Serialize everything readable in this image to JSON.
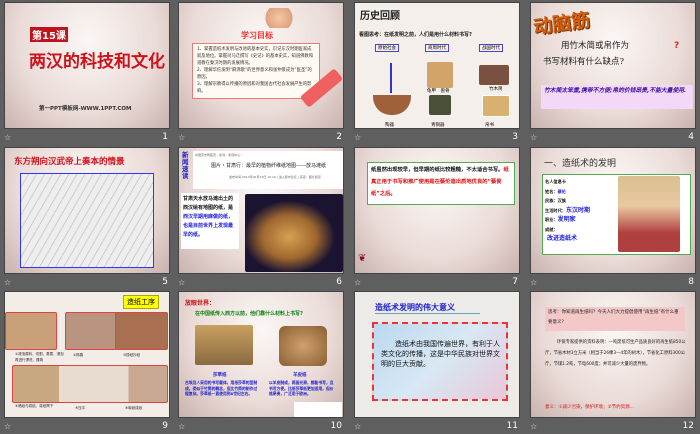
{
  "slides": [
    {
      "number": "1",
      "lesson": "第15课",
      "title": "两汉的科技和文化",
      "footer": "第一PPT模板网-WWW.1PPT.COM"
    },
    {
      "number": "2",
      "heading": "学习目标",
      "items": [
        "1、掌握造纸术发明与改进的基本史实，识记东汉时期医家成就及地位。掌握司马迁撰写《史记》的基本史实，知道佛教和道教在秦汉时期的发展情况。",
        "2、理解华佗发明“麻沸散”的世界意义和张仲景成为“医圣”的原因。",
        "3、理解宗教得以传播的原因和对我国古代社会发展产生的影响。"
      ]
    },
    {
      "number": "3",
      "logo": "历史回顾",
      "question": "看图思考：在纸发明之前，人们是用什么材料书写?",
      "eras": [
        "原始社会",
        "商周时代",
        "战国时代"
      ],
      "labels": [
        "陶器",
        "龟甲　兽骨",
        "青铜器",
        "竹木简",
        "帛书"
      ]
    },
    {
      "number": "4",
      "banner": "动脑筋",
      "question_line1": "用竹木简或帛作为",
      "question_line2": "书写材料有什么缺点?",
      "answer": "竹木简太笨重,携带不方便;帛的价钱昂贵,不能大量使用."
    },
    {
      "number": "5",
      "title": "东方朔向汉武帝上奏本的情景"
    },
    {
      "number": "6",
      "side_title": "新闻速读",
      "breadcrumb": "中国历史网首页 › 新闻 › 新闻中心 ›",
      "headline": "图片・甘肃行：最早的植物纤维纸地图——放马滩纸",
      "meta": "发布时间:2013年09月23日 10:16 | 进入夏中论坛 | 来源：图片频道",
      "text_black": "甘肃天水放马滩出土的西汉绘有地图的纸，是",
      "text_blue": "西汉早期用麻做的纸，也是目前世界上发现最早的纸。"
    },
    {
      "number": "7",
      "text_black": "纸虽然出现较早，但早期的纸比较粗糙，不太适合书写。",
      "text_red": "纸真正用于书写和推广使用是在蔡伦造出质地优良的“蔡侯纸”之后",
      "text_end": "。"
    },
    {
      "number": "8",
      "title": "一、造纸术的发明",
      "card_title": "名人信息卡",
      "fields": [
        {
          "k": "姓名：",
          "v": "蔡伦"
        },
        {
          "k": "民族：",
          "v": "汉族"
        },
        {
          "k": "生活时代：",
          "v": "东汉时期"
        },
        {
          "k": "职业：",
          "v": "发明家"
        },
        {
          "k": "成就：",
          "v": ""
        }
      ],
      "achievement": "改进造纸术"
    },
    {
      "number": "9",
      "title": "造纸工序",
      "captions": [
        "①浸泡原料，切割，蒸煮，浸泡再进行漂洗，捶捣",
        "②捣春",
        "③捞纸抄纸",
        "④晒纸与烘焙，将纸揭下",
        "⑤压平",
        "⑥晾纸成纸"
      ]
    },
    {
      "number": "10",
      "heading": "放眼世界：",
      "question": "在中国纸传入西方以前，他们靠什么材料上书写?",
      "left_title": "莎草纸",
      "left_text": "古埃及人采用的书写载体，用纸莎草的茎制成。类似于竹简的概念，但比竹简的制作过程复杂。莎草纸一直使用到8世纪左右。",
      "right_title": "羊皮纸",
      "right_text": "以羊皮制成，两面光滑，都能书写，且书写方便。比纸莎草纸更加适用，但价格昂贵，广泛用于欧洲。"
    },
    {
      "number": "11",
      "title": "造纸术发明的伟大意义",
      "text": "造纸术由我国传遍世界，有利于人类文化的传播，这是中华民族对世界文明的巨大贡献。"
    },
    {
      "number": "12",
      "question": "思考：你知道再生纸吗？今天人们大力提倡使用“再生纸”有什么重要意义？",
      "body": "环保专家提供的资料表明：一吨废纸可生产品质良好的再生纸850公斤，节省木材3立方米（相当于26棵3—4年的树木），节省化工原料300公斤，节煤1.2吨，节电600度；并可减少大量的废弃物。",
      "meaning": "意义：①减少污染，保护环境；②节约资源…"
    }
  ],
  "colors": {
    "background": "#5f5f5f",
    "title_red": "#d0101a",
    "accent_blue": "#1010e0"
  },
  "icons": {
    "transition": "star-icon"
  }
}
